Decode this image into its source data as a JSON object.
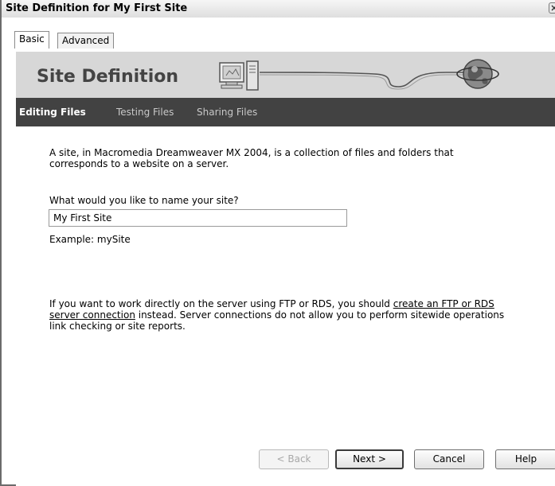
{
  "window": {
    "title": "Site Definition for My First Site"
  },
  "tabs": [
    {
      "label": "Basic",
      "selected": true
    },
    {
      "label": "Advanced",
      "selected": false
    }
  ],
  "banner": {
    "title": "Site Definition"
  },
  "steps": [
    {
      "label": "Editing Files",
      "active": true
    },
    {
      "label": "Testing Files",
      "active": false
    },
    {
      "label": "Sharing Files",
      "active": false
    }
  ],
  "content": {
    "intro": "A site, in Macromedia Dreamweaver MX 2004, is a collection of files and folders that corresponds to a website on a server.",
    "question": "What would you like to name your site?",
    "site_name_value": "My First Site",
    "example": "Example: mySite",
    "server_text_before": "If you want to work directly on the server using FTP or RDS, you should ",
    "server_link": "create an FTP or RDS server connection",
    "server_text_after": " instead. Server connections do not allow you to perform sitewide operations link checking or site reports."
  },
  "buttons": {
    "back": "< Back",
    "next": "Next >",
    "cancel": "Cancel",
    "help": "Help"
  },
  "colors": {
    "banner_bg": "#d7d7d7",
    "stepbar_bg": "#424242",
    "titlebar_bg": "#e6e6e6"
  }
}
